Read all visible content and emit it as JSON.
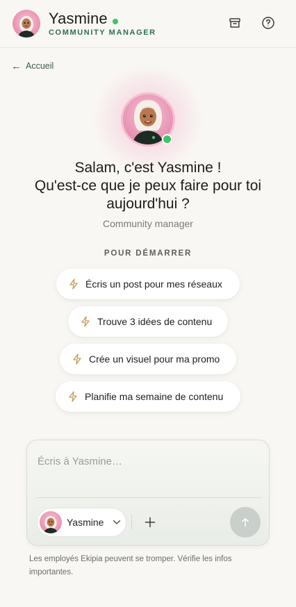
{
  "header": {
    "name": "Yasmine",
    "role": "COMMUNITY MANAGER",
    "icons": {
      "archive": "archive-icon",
      "help": "help-circle-icon"
    }
  },
  "back": {
    "label": "Accueil"
  },
  "hero": {
    "greeting": "Salam, c'est Yasmine !\nQu'est-ce que je peux faire pour toi\naujourd'hui ?",
    "subtitle": "Community manager"
  },
  "suggestions": {
    "label": "POUR DÉMARRER",
    "items": [
      {
        "label": "Écris un post pour mes réseaux"
      },
      {
        "label": "Trouve 3 idées de contenu"
      },
      {
        "label": "Crée un visuel pour ma promo"
      },
      {
        "label": "Planifie ma semaine de contenu"
      }
    ]
  },
  "composer": {
    "placeholder": "Écris à Yasmine…",
    "value": "",
    "agent": "Yasmine"
  },
  "disclaimer": "Les employés Ekipia peuvent se tromper. Vérifie les infos importantes.",
  "colors": {
    "accent": "#2f6f57",
    "online": "#3fc36a",
    "avatar_pink": "#e98fb0"
  }
}
